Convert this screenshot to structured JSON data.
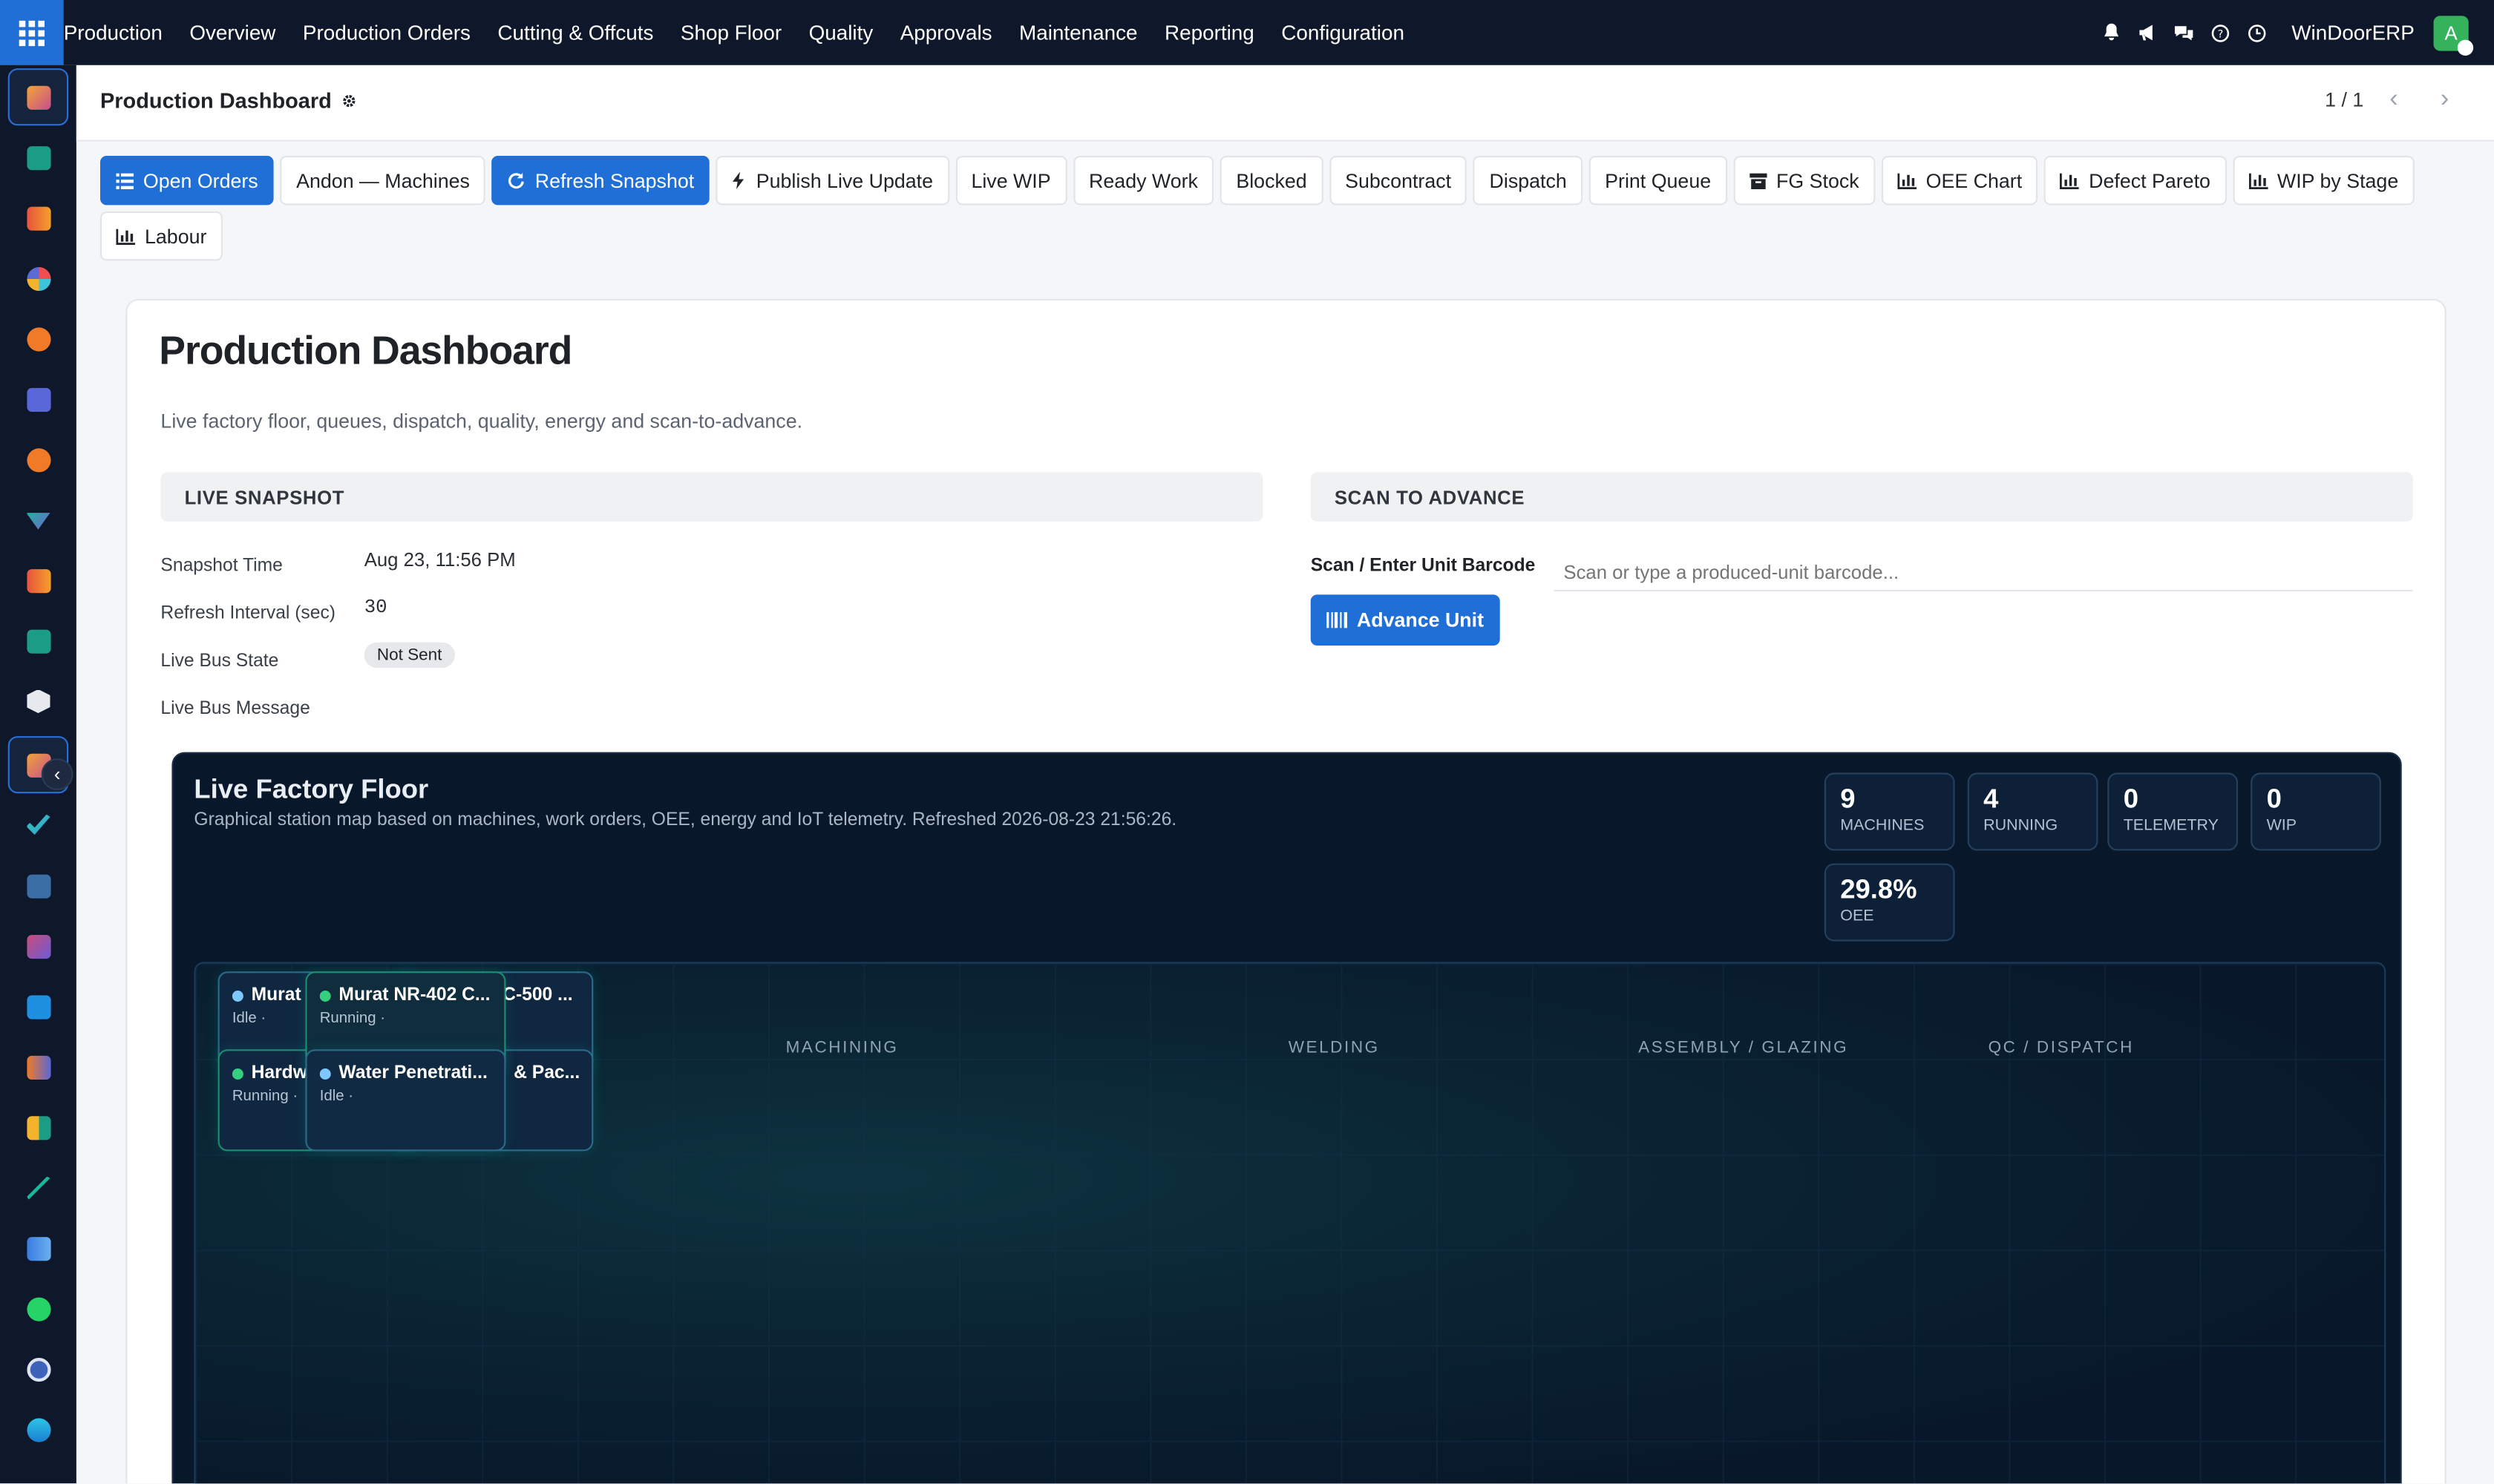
{
  "topbar": {
    "brand": "Production",
    "menu": [
      "Overview",
      "Production Orders",
      "Cutting & Offcuts",
      "Shop Floor",
      "Quality",
      "Approvals",
      "Maintenance",
      "Reporting",
      "Configuration"
    ],
    "company": "WinDoorERP",
    "avatar": "A"
  },
  "page": {
    "title": "Production Dashboard",
    "pager": "1 / 1"
  },
  "toolbar": {
    "buttons": [
      {
        "label": "Open Orders",
        "primary": true,
        "icon": "list-icon"
      },
      {
        "label": "Andon — Machines",
        "primary": false,
        "icon": ""
      },
      {
        "label": "Refresh Snapshot",
        "primary": true,
        "icon": "refresh-icon"
      },
      {
        "label": "Publish Live Update",
        "primary": false,
        "icon": "bolt-icon"
      },
      {
        "label": "Live WIP",
        "primary": false,
        "icon": ""
      },
      {
        "label": "Ready Work",
        "primary": false,
        "icon": ""
      },
      {
        "label": "Blocked",
        "primary": false,
        "icon": ""
      },
      {
        "label": "Subcontract",
        "primary": false,
        "icon": ""
      },
      {
        "label": "Dispatch",
        "primary": false,
        "icon": ""
      },
      {
        "label": "Print Queue",
        "primary": false,
        "icon": ""
      },
      {
        "label": "FG Stock",
        "primary": false,
        "icon": "archive-icon"
      },
      {
        "label": "OEE Chart",
        "primary": false,
        "icon": "bar-chart-icon"
      },
      {
        "label": "Defect Pareto",
        "primary": false,
        "icon": "bar-chart-icon"
      },
      {
        "label": "WIP by Stage",
        "primary": false,
        "icon": "bar-chart-icon"
      },
      {
        "label": "Labour",
        "primary": false,
        "icon": "bar-chart-icon"
      }
    ]
  },
  "dashboard": {
    "heading": "Production Dashboard",
    "subtitle": "Live factory floor, queues, dispatch, quality, energy and scan-to-advance.",
    "snapshot": {
      "header": "LIVE SNAPSHOT",
      "time_label": "Snapshot Time",
      "time_value": "Aug 23, 11:56 PM",
      "interval_label": "Refresh Interval (sec)",
      "interval_value": "30",
      "bus_state_label": "Live Bus State",
      "bus_state_value": "Not Sent",
      "bus_msg_label": "Live Bus Message"
    },
    "scan": {
      "header": "SCAN TO ADVANCE",
      "label": "Scan / Enter Unit Barcode",
      "placeholder": "Scan or type a produced-unit barcode...",
      "button": "Advance Unit"
    }
  },
  "floor": {
    "title": "Live Factory Floor",
    "subtitle": "Graphical station map based on machines, work orders, OEE, energy and IoT telemetry. Refreshed 2026-08-23 21:56:26.",
    "kpis": [
      {
        "value": "9",
        "label": "MACHINES"
      },
      {
        "value": "4",
        "label": "RUNNING"
      },
      {
        "value": "0",
        "label": "TELEMETRY"
      },
      {
        "value": "0",
        "label": "WIP"
      },
      {
        "value": "29.8%",
        "label": "OEE"
      }
    ],
    "zones": [
      "MACHINING",
      "WELDING",
      "ASSEMBLY / GLAZING",
      "QC / DISPATCH"
    ],
    "machines": [
      {
        "name": "Murat",
        "status": "Idle ·",
        "dot": "#7cc8ff"
      },
      {
        "name": "C-500 ...",
        "status": "",
        "dot": "#7cc8ff"
      },
      {
        "name": "Hardw",
        "status": "Running ·",
        "dot": "#35d07f"
      },
      {
        "name": "& Pac...",
        "status": "",
        "dot": "#7cc8ff"
      },
      {
        "name": "Murat NR-402 C...",
        "status": "Running ·",
        "dot": "#35d07f"
      },
      {
        "name": "Water Penetrati...",
        "status": "Idle ·",
        "dot": "#7cc8ff"
      }
    ]
  },
  "colors": {
    "accent": "#1f6fd6",
    "topbar": "#0f172a",
    "floor_bg": "#08182a",
    "running": "#35d07f",
    "idle": "#7cc8ff"
  }
}
